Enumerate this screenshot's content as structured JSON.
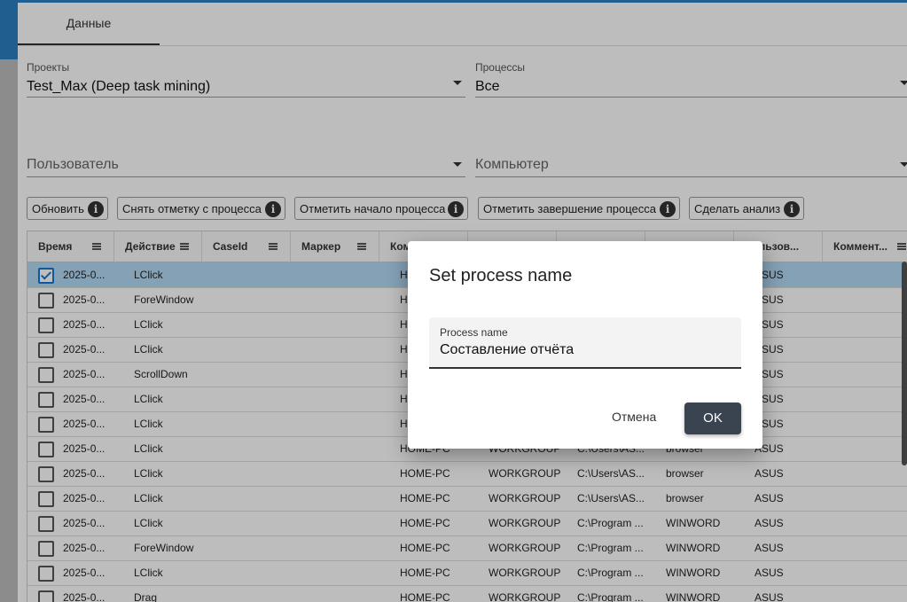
{
  "tabs": [
    {
      "label": "Данные"
    }
  ],
  "filters": {
    "projects": {
      "label": "Проекты",
      "value": "Test_Max (Deep task mining)"
    },
    "processes": {
      "label": "Процессы",
      "value": "Все"
    },
    "user": {
      "placeholder": "Пользователь"
    },
    "computer": {
      "placeholder": "Компьютер"
    }
  },
  "toolbar": {
    "refresh": "Обновить",
    "unmark": "Снять отметку с процесса",
    "mark_start": "Отметить начало процесса",
    "mark_end": "Отметить завершение процесса",
    "analyze": "Сделать анализ",
    "info_icon": "i"
  },
  "grid": {
    "columns": [
      "Время",
      "Действие",
      "CaseId",
      "Маркер",
      "Ком",
      "",
      "",
      "",
      "Пользов...",
      "Коммент..."
    ],
    "rows": [
      {
        "checked": true,
        "time": "2025-0...",
        "action": "LClick",
        "computer": "HO",
        "domain": "",
        "path": "",
        "app": "",
        "user": "ASUS"
      },
      {
        "checked": false,
        "time": "2025-0...",
        "action": "ForeWindow",
        "computer": "HO",
        "domain": "",
        "path": "",
        "app": "",
        "user": "ASUS"
      },
      {
        "checked": false,
        "time": "2025-0...",
        "action": "LClick",
        "computer": "HO",
        "domain": "",
        "path": "",
        "app": "",
        "user": "ASUS"
      },
      {
        "checked": false,
        "time": "2025-0...",
        "action": "LClick",
        "computer": "HO",
        "domain": "",
        "path": "",
        "app": "",
        "user": "ASUS"
      },
      {
        "checked": false,
        "time": "2025-0...",
        "action": "ScrollDown",
        "computer": "HO",
        "domain": "",
        "path": "",
        "app": "",
        "user": "ASUS"
      },
      {
        "checked": false,
        "time": "2025-0...",
        "action": "LClick",
        "computer": "HO",
        "domain": "",
        "path": "",
        "app": "",
        "user": "ASUS"
      },
      {
        "checked": false,
        "time": "2025-0...",
        "action": "LClick",
        "computer": "HO",
        "domain": "",
        "path": "",
        "app": "",
        "user": "ASUS"
      },
      {
        "checked": false,
        "time": "2025-0...",
        "action": "LClick",
        "computer": "HOME-PC",
        "domain": "WORKGROUP",
        "path": "C:\\Users\\AS...",
        "app": "browser",
        "user": "ASUS"
      },
      {
        "checked": false,
        "time": "2025-0...",
        "action": "LClick",
        "computer": "HOME-PC",
        "domain": "WORKGROUP",
        "path": "C:\\Users\\AS...",
        "app": "browser",
        "user": "ASUS"
      },
      {
        "checked": false,
        "time": "2025-0...",
        "action": "LClick",
        "computer": "HOME-PC",
        "domain": "WORKGROUP",
        "path": "C:\\Users\\AS...",
        "app": "browser",
        "user": "ASUS"
      },
      {
        "checked": false,
        "time": "2025-0...",
        "action": "LClick",
        "computer": "HOME-PC",
        "domain": "WORKGROUP",
        "path": "C:\\Program ...",
        "app": "WINWORD",
        "user": "ASUS"
      },
      {
        "checked": false,
        "time": "2025-0...",
        "action": "ForeWindow",
        "computer": "HOME-PC",
        "domain": "WORKGROUP",
        "path": "C:\\Program ...",
        "app": "WINWORD",
        "user": "ASUS"
      },
      {
        "checked": false,
        "time": "2025-0...",
        "action": "LClick",
        "computer": "HOME-PC",
        "domain": "WORKGROUP",
        "path": "C:\\Program ...",
        "app": "WINWORD",
        "user": "ASUS"
      },
      {
        "checked": false,
        "time": "2025-0...",
        "action": "Drag",
        "computer": "HOME-PC",
        "domain": "WORKGROUP",
        "path": "C:\\Program ...",
        "app": "WINWORD",
        "user": "ASUS"
      }
    ]
  },
  "dialog": {
    "title": "Set process name",
    "input_label": "Process name",
    "input_value": "Составление отчёта",
    "cancel": "Отмена",
    "ok": "OK"
  },
  "colors": {
    "accent": "#2a7fc0",
    "selected_row": "#b3d9f5",
    "ok_button": "#3a4350"
  }
}
